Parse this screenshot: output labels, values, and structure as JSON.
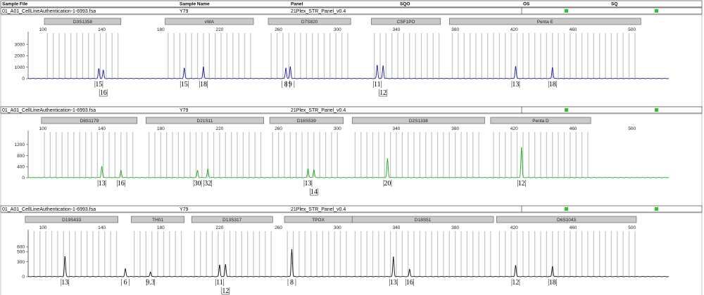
{
  "header_columns": [
    "Sample File",
    "Sample Name",
    "Panel",
    "SQO",
    "OS",
    "SQ"
  ],
  "quality_color": "#22cc22",
  "panels": [
    {
      "sample_file": "01_A01_CellLineAuthentication-1-6993.fsa",
      "sample_name": "Y79",
      "panel_name": "21Plex_STR_Panel_v0.4",
      "color": "#1a1aa0",
      "markers": [
        {
          "name": "D3S1358",
          "start": 101,
          "end": 153
        },
        {
          "name": "vWA",
          "start": 183,
          "end": 243
        },
        {
          "name": "D7S820",
          "start": 253,
          "end": 309
        },
        {
          "name": "CSF1PO",
          "start": 323,
          "end": 370
        },
        {
          "name": "Penta E",
          "start": 376,
          "end": 506
        }
      ]
    },
    {
      "sample_file": "01_A01_CellLineAuthentication-1-6993.fsa",
      "sample_name": "Y79",
      "panel_name": "21Plex_STR_Panel_v0.4",
      "color": "#22aa22",
      "markers": [
        {
          "name": "D8S1179",
          "start": 99,
          "end": 164
        },
        {
          "name": "D21S11",
          "start": 170,
          "end": 250
        },
        {
          "name": "D16S539",
          "start": 254,
          "end": 304
        },
        {
          "name": "D2S1338",
          "start": 310,
          "end": 400
        },
        {
          "name": "Penta D",
          "start": 404,
          "end": 472
        }
      ]
    },
    {
      "sample_file": "01_A01_CellLineAuthentication-1-6993.fsa",
      "sample_name": "Y79",
      "panel_name": "21Plex_STR_Panel_v0.4",
      "color": "#111111",
      "markers": [
        {
          "name": "D19S433",
          "start": 88,
          "end": 151
        },
        {
          "name": "TH01",
          "start": 160,
          "end": 196
        },
        {
          "name": "D13S317",
          "start": 201,
          "end": 256
        },
        {
          "name": "TPOX",
          "start": 264,
          "end": 310
        },
        {
          "name": "D18S51",
          "start": 310,
          "end": 406
        },
        {
          "name": "D6S1043",
          "start": 408,
          "end": 503
        }
      ]
    }
  ],
  "chart_data": [
    {
      "type": "line",
      "channel": "blue",
      "xlim": [
        90,
        525
      ],
      "x_ticks": [
        100,
        140,
        180,
        220,
        260,
        300,
        340,
        380,
        420,
        460,
        500
      ],
      "ylim": [
        0,
        3500
      ],
      "y_ticks": [
        0,
        1000,
        2000,
        3000
      ],
      "peaks": [
        {
          "x": 138,
          "height": 850
        },
        {
          "x": 141,
          "height": 700
        },
        {
          "x": 196,
          "height": 900
        },
        {
          "x": 209,
          "height": 1000
        },
        {
          "x": 265,
          "height": 900
        },
        {
          "x": 268,
          "height": 1020
        },
        {
          "x": 327,
          "height": 1150
        },
        {
          "x": 331,
          "height": 1100
        },
        {
          "x": 421,
          "height": 1050
        },
        {
          "x": 446,
          "height": 950
        }
      ],
      "alleles": [
        {
          "x": 138,
          "label": "15",
          "row": 0
        },
        {
          "x": 141,
          "label": "16",
          "row": 1
        },
        {
          "x": 196,
          "label": "15",
          "row": 0
        },
        {
          "x": 209,
          "label": "18",
          "row": 0
        },
        {
          "x": 265,
          "label": "8",
          "row": 0
        },
        {
          "x": 268,
          "label": "9",
          "row": 0
        },
        {
          "x": 327,
          "label": "11",
          "row": 0
        },
        {
          "x": 331,
          "label": "12",
          "row": 1
        },
        {
          "x": 421,
          "label": "13",
          "row": 0
        },
        {
          "x": 446,
          "label": "18",
          "row": 0
        }
      ]
    },
    {
      "type": "line",
      "channel": "green",
      "xlim": [
        90,
        525
      ],
      "x_ticks": [
        100,
        140,
        180,
        220,
        260,
        300,
        340,
        380,
        420,
        460,
        500
      ],
      "ylim": [
        0,
        1450
      ],
      "y_ticks": [
        0,
        400,
        800,
        1200
      ],
      "peaks": [
        {
          "x": 140,
          "height": 400
        },
        {
          "x": 153,
          "height": 250
        },
        {
          "x": 205,
          "height": 250
        },
        {
          "x": 212,
          "height": 300
        },
        {
          "x": 280,
          "height": 320
        },
        {
          "x": 284,
          "height": 280
        },
        {
          "x": 334,
          "height": 680
        },
        {
          "x": 425,
          "height": 1080
        }
      ],
      "alleles": [
        {
          "x": 140,
          "label": "13",
          "row": 0
        },
        {
          "x": 153,
          "label": "16",
          "row": 0
        },
        {
          "x": 205,
          "label": "30",
          "row": 0
        },
        {
          "x": 212,
          "label": "32",
          "row": 0
        },
        {
          "x": 280,
          "label": "13",
          "row": 0
        },
        {
          "x": 284,
          "label": "14",
          "row": 1
        },
        {
          "x": 334,
          "label": "20",
          "row": 0
        },
        {
          "x": 425,
          "label": "12",
          "row": 0
        }
      ]
    },
    {
      "type": "line",
      "channel": "yellow",
      "xlim": [
        90,
        525
      ],
      "x_ticks": [
        100,
        140,
        180,
        220,
        260,
        300,
        340,
        380,
        420,
        460,
        500
      ],
      "ylim": [
        0,
        800
      ],
      "y_ticks": [
        0,
        300,
        500,
        600
      ],
      "peaks": [
        {
          "x": 115,
          "height": 400
        },
        {
          "x": 156,
          "height": 150
        },
        {
          "x": 173,
          "height": 90
        },
        {
          "x": 220,
          "height": 230
        },
        {
          "x": 224,
          "height": 240
        },
        {
          "x": 269,
          "height": 540
        },
        {
          "x": 338,
          "height": 390
        },
        {
          "x": 349,
          "height": 140
        },
        {
          "x": 421,
          "height": 220
        },
        {
          "x": 446,
          "height": 200
        }
      ],
      "alleles": [
        {
          "x": 115,
          "label": "13",
          "row": 0
        },
        {
          "x": 156,
          "label": "6",
          "row": 0
        },
        {
          "x": 173,
          "label": "9.3",
          "row": 0
        },
        {
          "x": 220,
          "label": "11",
          "row": 0
        },
        {
          "x": 224,
          "label": "12",
          "row": 1
        },
        {
          "x": 269,
          "label": "8",
          "row": 0
        },
        {
          "x": 338,
          "label": "13",
          "row": 0
        },
        {
          "x": 349,
          "label": "16",
          "row": 0
        },
        {
          "x": 421,
          "label": "12",
          "row": 0
        },
        {
          "x": 446,
          "label": "18",
          "row": 0
        }
      ]
    }
  ]
}
